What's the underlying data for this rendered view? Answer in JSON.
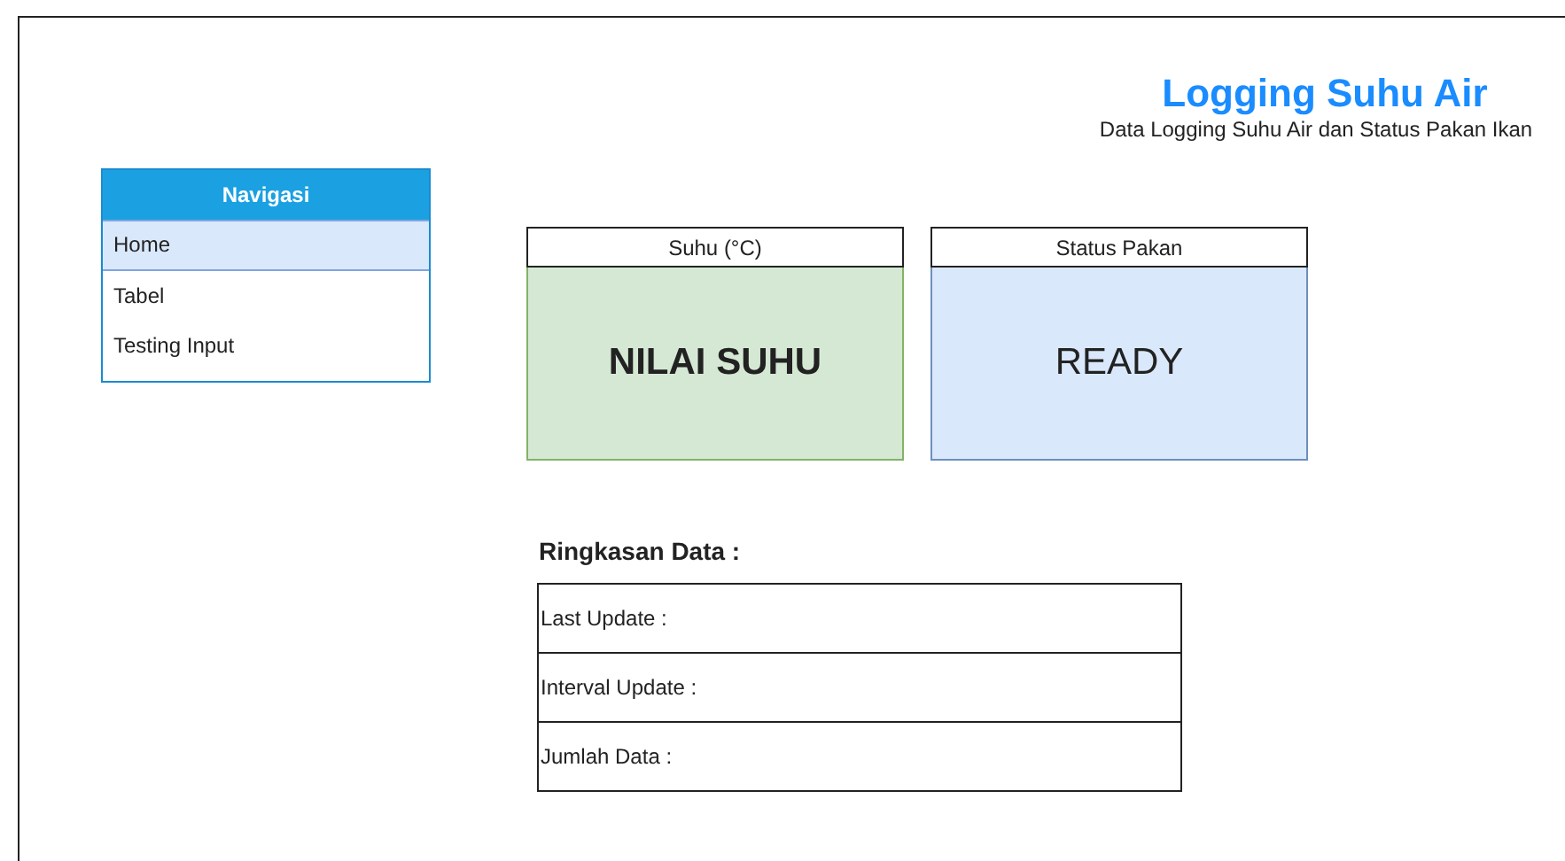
{
  "header": {
    "title": "Logging Suhu Air",
    "subtitle": "Data Logging Suhu Air dan Status Pakan Ikan"
  },
  "navigation": {
    "title": "Navigasi",
    "items": [
      {
        "label": "Home",
        "selected": true
      },
      {
        "label": "Tabel",
        "selected": false
      },
      {
        "label": "Testing Input",
        "selected": false
      }
    ]
  },
  "cards": [
    {
      "kind": "temperature",
      "title": "Suhu (°C)",
      "value": "NILAI SUHU"
    },
    {
      "kind": "status",
      "title": "Status Pakan",
      "value": "READY"
    }
  ],
  "summary": {
    "title": "Ringkasan Data :",
    "rows": [
      "Last Update :",
      "Interval Update :",
      "Jumlah Data :"
    ]
  }
}
